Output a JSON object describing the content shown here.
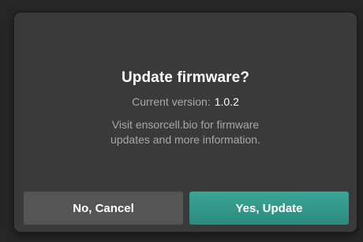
{
  "dialog": {
    "title": "Update firmware?",
    "version_label": "Current version:",
    "version_value": "1.0.2",
    "info_line1": "Visit ensorcell.bio for firmware",
    "info_line2": "updates and more information.",
    "cancel_label": "No, Cancel",
    "confirm_label": "Yes, Update"
  },
  "colors": {
    "background": "#262626",
    "dialog": "#3a3a3a",
    "cancel_button": "#555555",
    "confirm_button": "#2f9487",
    "secondary_text": "#a8a8a8",
    "primary_text": "#ffffff"
  }
}
